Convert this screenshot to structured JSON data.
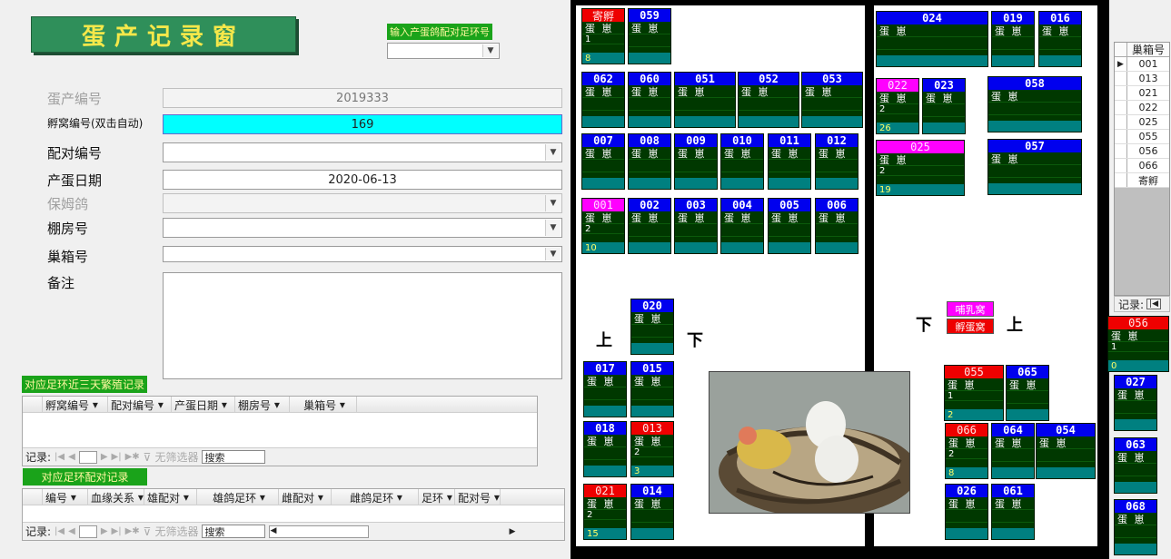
{
  "form": {
    "title": "蛋产记录窗",
    "pair_ring_label": "输入产蛋鸽配对足环号",
    "fields": {
      "egg_no": {
        "label": "蛋产编号",
        "value": "2019333"
      },
      "nest_no": {
        "label": "孵窝编号(双击自动)",
        "value": "169"
      },
      "pair_no": {
        "label": "配对编号",
        "value": ""
      },
      "lay_date": {
        "label": "产蛋日期",
        "value": "2020-06-13"
      },
      "nanny": {
        "label": "保姆鸽",
        "value": ""
      },
      "loft": {
        "label": "棚房号",
        "value": ""
      },
      "nest_box": {
        "label": "巢箱号",
        "value": ""
      },
      "remark": {
        "label": "备注",
        "value": ""
      }
    }
  },
  "sub1": {
    "title": "对应足环近三天繁殖记录",
    "columns": [
      "孵窝编号",
      "配对编号",
      "产蛋日期",
      "棚房号",
      "巢箱号"
    ],
    "nav": {
      "records_label": "记录:",
      "filter_label": "无筛选器",
      "search_label": "搜索"
    }
  },
  "sub2": {
    "title": "对应足环配对记录",
    "columns": [
      "编号",
      "血缘关系",
      "雄配对",
      "雄鸽足环",
      "雌配对",
      "雌鸽足环",
      "足环",
      "配对号"
    ],
    "nav": {
      "records_label": "记录:",
      "filter_label": "无筛选器",
      "search_label": "搜索"
    }
  },
  "cards": [
    {
      "id": "c_jf",
      "num": "寄孵",
      "hd": "red",
      "rows": [
        "蛋 崽",
        "1"
      ],
      "ft": "8"
    },
    {
      "id": "c059",
      "num": "059",
      "hd": "blue",
      "rows": [
        "蛋 崽"
      ],
      "ft": ""
    },
    {
      "id": "c062",
      "num": "062",
      "hd": "blue",
      "rows": [
        "蛋 崽"
      ],
      "ft": ""
    },
    {
      "id": "c060",
      "num": "060",
      "hd": "blue",
      "rows": [
        "蛋 崽"
      ],
      "ft": ""
    },
    {
      "id": "c051",
      "num": "051",
      "hd": "blue",
      "rows": [
        "蛋 崽"
      ],
      "ft": ""
    },
    {
      "id": "c052",
      "num": "052",
      "hd": "blue",
      "rows": [
        "蛋 崽"
      ],
      "ft": ""
    },
    {
      "id": "c053",
      "num": "053",
      "hd": "blue",
      "rows": [
        "蛋 崽"
      ],
      "ft": ""
    },
    {
      "id": "c007",
      "num": "007",
      "hd": "blue",
      "rows": [
        "蛋 崽"
      ],
      "ft": ""
    },
    {
      "id": "c008",
      "num": "008",
      "hd": "blue",
      "rows": [
        "蛋 崽"
      ],
      "ft": ""
    },
    {
      "id": "c009",
      "num": "009",
      "hd": "blue",
      "rows": [
        "蛋 崽"
      ],
      "ft": ""
    },
    {
      "id": "c010",
      "num": "010",
      "hd": "blue",
      "rows": [
        "蛋 崽"
      ],
      "ft": ""
    },
    {
      "id": "c011",
      "num": "011",
      "hd": "blue",
      "rows": [
        "蛋 崽"
      ],
      "ft": ""
    },
    {
      "id": "c012",
      "num": "012",
      "hd": "blue",
      "rows": [
        "蛋 崽"
      ],
      "ft": ""
    },
    {
      "id": "c001",
      "num": "001",
      "hd": "pink",
      "rows": [
        "蛋 崽",
        "2"
      ],
      "ft": "10"
    },
    {
      "id": "c002",
      "num": "002",
      "hd": "blue",
      "rows": [
        "蛋 崽"
      ],
      "ft": ""
    },
    {
      "id": "c003",
      "num": "003",
      "hd": "blue",
      "rows": [
        "蛋 崽"
      ],
      "ft": ""
    },
    {
      "id": "c004",
      "num": "004",
      "hd": "blue",
      "rows": [
        "蛋 崽"
      ],
      "ft": ""
    },
    {
      "id": "c005",
      "num": "005",
      "hd": "blue",
      "rows": [
        "蛋 崽"
      ],
      "ft": ""
    },
    {
      "id": "c006",
      "num": "006",
      "hd": "blue",
      "rows": [
        "蛋 崽"
      ],
      "ft": ""
    },
    {
      "id": "c020",
      "num": "020",
      "hd": "blue",
      "rows": [
        "蛋 崽"
      ],
      "ft": ""
    },
    {
      "id": "c017",
      "num": "017",
      "hd": "blue",
      "rows": [
        "蛋 崽"
      ],
      "ft": ""
    },
    {
      "id": "c015",
      "num": "015",
      "hd": "blue",
      "rows": [
        "蛋 崽"
      ],
      "ft": ""
    },
    {
      "id": "c018",
      "num": "018",
      "hd": "blue",
      "rows": [
        "蛋 崽"
      ],
      "ft": ""
    },
    {
      "id": "c013",
      "num": "013",
      "hd": "red",
      "rows": [
        "蛋 崽",
        "2"
      ],
      "ft": "3"
    },
    {
      "id": "c021",
      "num": "021",
      "hd": "red",
      "rows": [
        "蛋 崽",
        "2"
      ],
      "ft": "15"
    },
    {
      "id": "c014",
      "num": "014",
      "hd": "blue",
      "rows": [
        "蛋 崽"
      ],
      "ft": ""
    },
    {
      "id": "c024",
      "num": "024",
      "hd": "blue",
      "rows": [
        "蛋 崽"
      ],
      "ft": ""
    },
    {
      "id": "c019",
      "num": "019",
      "hd": "blue",
      "rows": [
        "蛋 崽"
      ],
      "ft": ""
    },
    {
      "id": "c016",
      "num": "016",
      "hd": "blue",
      "rows": [
        "蛋 崽"
      ],
      "ft": ""
    },
    {
      "id": "c022",
      "num": "022",
      "hd": "pink",
      "rows": [
        "蛋 崽",
        "2"
      ],
      "ft": "26"
    },
    {
      "id": "c023",
      "num": "023",
      "hd": "blue",
      "rows": [
        "蛋 崽"
      ],
      "ft": ""
    },
    {
      "id": "c058",
      "num": "058",
      "hd": "blue",
      "rows": [
        "蛋 崽"
      ],
      "ft": ""
    },
    {
      "id": "c025",
      "num": "025",
      "hd": "pink",
      "rows": [
        "蛋 崽",
        "2"
      ],
      "ft": "19"
    },
    {
      "id": "c057",
      "num": "057",
      "hd": "blue",
      "rows": [
        "蛋 崽"
      ],
      "ft": ""
    },
    {
      "id": "c055",
      "num": "055",
      "hd": "red",
      "rows": [
        "蛋 崽",
        "1"
      ],
      "ft": "2"
    },
    {
      "id": "c065",
      "num": "065",
      "hd": "blue",
      "rows": [
        "蛋 崽"
      ],
      "ft": ""
    },
    {
      "id": "c066",
      "num": "066",
      "hd": "red",
      "rows": [
        "蛋 崽",
        "2"
      ],
      "ft": "8"
    },
    {
      "id": "c064",
      "num": "064",
      "hd": "blue",
      "rows": [
        "蛋 崽"
      ],
      "ft": ""
    },
    {
      "id": "c054",
      "num": "054",
      "hd": "blue",
      "rows": [
        "蛋 崽"
      ],
      "ft": ""
    },
    {
      "id": "c026",
      "num": "026",
      "hd": "blue",
      "rows": [
        "蛋 崽"
      ],
      "ft": ""
    },
    {
      "id": "c061",
      "num": "061",
      "hd": "blue",
      "rows": [
        "蛋 崽"
      ],
      "ft": ""
    },
    {
      "id": "c056",
      "num": "056",
      "hd": "red",
      "rows": [
        "蛋 崽",
        "1"
      ],
      "ft": "0"
    },
    {
      "id": "c027",
      "num": "027",
      "hd": "blue",
      "rows": [
        "蛋 崽"
      ],
      "ft": ""
    },
    {
      "id": "c063",
      "num": "063",
      "hd": "blue",
      "rows": [
        "蛋 崽"
      ],
      "ft": ""
    },
    {
      "id": "c068",
      "num": "068",
      "hd": "blue",
      "rows": [
        "蛋 崽"
      ],
      "ft": ""
    }
  ],
  "panel": {
    "up": "上",
    "down": "下",
    "badge_feed": "哺乳窝",
    "badge_hatch": "孵蛋窝"
  },
  "list": {
    "header": "巢箱号",
    "items": [
      "001",
      "013",
      "021",
      "022",
      "025",
      "055",
      "056",
      "066",
      "寄孵"
    ],
    "records_label": "记录:"
  },
  "colors": {
    "card_bg": "#003800",
    "header_blue": "#0000ee",
    "header_red": "#ee0000",
    "header_pink": "#ff00ff",
    "footer_teal": "#008080",
    "title_green": "#2f8f5a",
    "nest_cyan": "#00ffff"
  }
}
